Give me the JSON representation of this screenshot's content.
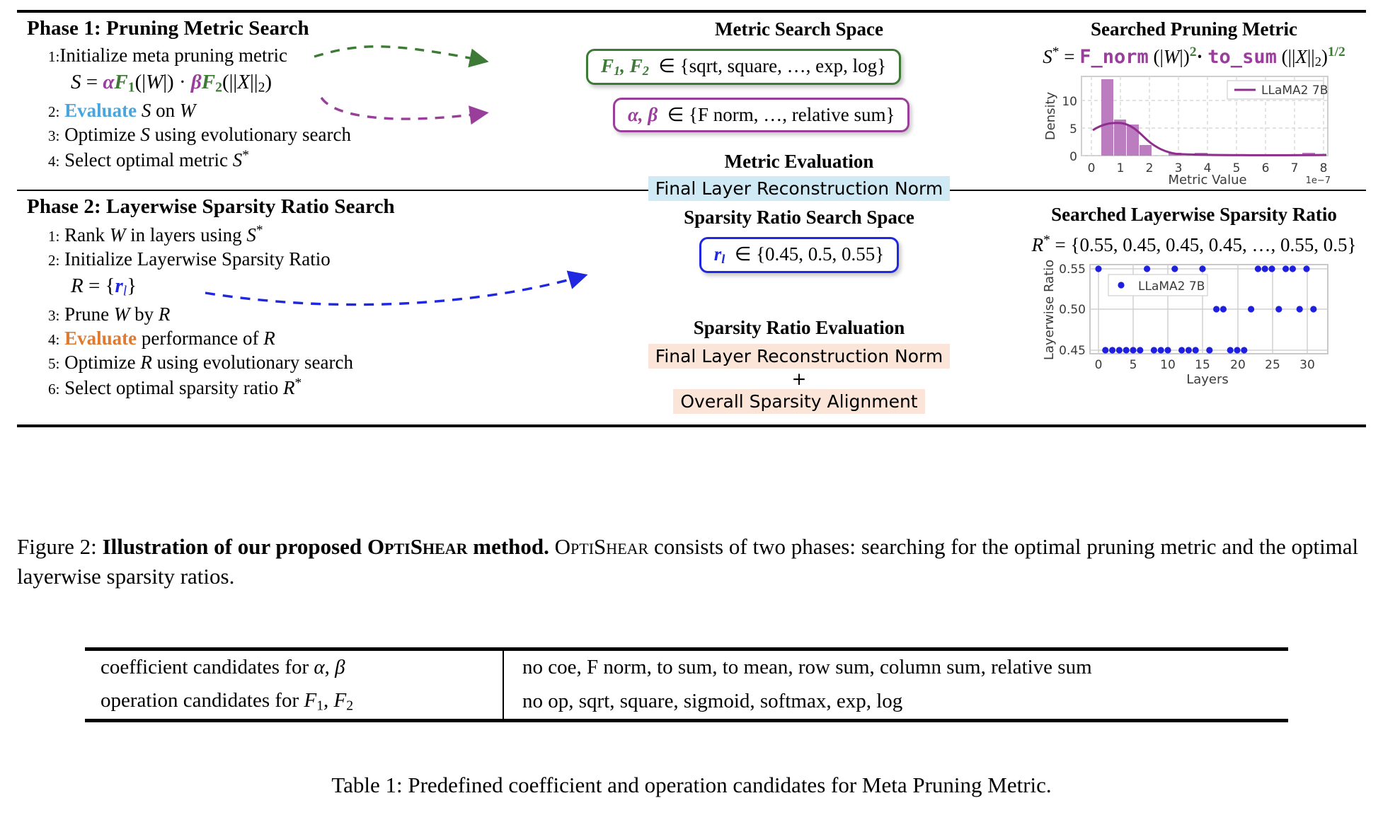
{
  "phase1": {
    "title": "Phase 1: Pruning Metric Search",
    "steps": [
      {
        "num": "1:",
        "text": "Initialize meta pruning metric"
      },
      {
        "num": "2:",
        "text": "Evaluate S on W"
      },
      {
        "num": "3:",
        "text": "Optimize S using evolutionary search"
      },
      {
        "num": "4:",
        "text": "Select optimal metric S*"
      }
    ],
    "equation": "S = αF₁(|W|) · βF₂(||X||₂)",
    "space_heading": "Metric Search Space",
    "space_box_1": "F₁, F₂ ∈ {sqrt, square, …, exp, log}",
    "space_box_2": "α, β ∈ {F norm, …, relative sum}",
    "eval_heading": "Metric Evaluation",
    "eval_item": "Final Layer Reconstruction Norm",
    "plot_heading": "Searched Pruning Metric",
    "plot_equation": "S* = F_norm (|W|)²· to_sum (||X||₂)¹ᐟ²"
  },
  "phase2": {
    "title": "Phase 2: Layerwise Sparsity Ratio Search",
    "steps": [
      {
        "num": "1:",
        "text": "Rank W in layers using S*"
      },
      {
        "num": "2:",
        "text": "Initialize Layerwise Sparsity Ratio"
      },
      {
        "num": "3:",
        "text": "Prune W by R"
      },
      {
        "num": "4:",
        "text": "Evaluate performance of R"
      },
      {
        "num": "5:",
        "text": "Optimize R using evolutionary search"
      },
      {
        "num": "6:",
        "text": "Select optimal sparsity ratio R*"
      }
    ],
    "equation": "R = {rₗ}",
    "space_heading": "Sparsity Ratio Search Space",
    "space_box_1": "rₗ ∈ {0.45, 0.5, 0.55}",
    "eval_heading": "Sparsity Ratio Evaluation",
    "eval_item_1": "Final Layer Reconstruction Norm",
    "eval_plus": "+",
    "eval_item_2": "Overall Sparsity Alignment",
    "plot_heading": "Searched Layerwise Sparsity Ratio",
    "plot_equation": "R* = {0.55, 0.45, 0.45, 0.45, …, 0.55, 0.5}"
  },
  "colors": {
    "purple": "#993f9b",
    "green": "#3c7a36",
    "blue": "#1f27e0",
    "light_blue": "#47a6dd",
    "orange": "#e07a2f",
    "highlight_blue": "#cfe9f5",
    "highlight_peach": "#fae5d8"
  },
  "chart_data": [
    {
      "type": "bar",
      "title": "",
      "xlabel": "Metric Value",
      "ylabel": "Density",
      "x_exponent": "1e−7",
      "xlim": [
        -0.35,
        8.6
      ],
      "ylim": [
        0,
        14.5
      ],
      "xticks": [
        "0",
        "1",
        "2",
        "3",
        "4",
        "5",
        "6",
        "7",
        "8"
      ],
      "yticks": [
        "0",
        "5",
        "10"
      ],
      "legend": [
        "LLaMA2 7B"
      ],
      "legend_position": "upper right",
      "grid": true,
      "bin_edges": [
        0.35,
        0.78,
        1.21,
        1.64,
        2.07,
        3.0,
        3.45,
        3.9,
        4.35,
        7.6,
        8.05
      ],
      "bars": [
        {
          "x0": 0.35,
          "x1": 0.78,
          "height": 13.9
        },
        {
          "x0": 0.78,
          "x1": 1.21,
          "height": 6.6
        },
        {
          "x0": 1.21,
          "x1": 1.64,
          "height": 5.7
        },
        {
          "x0": 1.64,
          "x1": 2.07,
          "height": 1.9
        },
        {
          "x0": 3.0,
          "x1": 3.45,
          "height": 0.55
        },
        {
          "x0": 3.9,
          "x1": 4.35,
          "height": 0.55
        },
        {
          "x0": 7.6,
          "x1": 8.05,
          "height": 0.55
        }
      ],
      "kde_curve": [
        [
          0.3,
          4.6
        ],
        [
          0.5,
          5.05
        ],
        [
          0.75,
          5.3
        ],
        [
          1.0,
          5.25
        ],
        [
          1.25,
          4.75
        ],
        [
          1.5,
          3.9
        ],
        [
          1.75,
          2.95
        ],
        [
          2.0,
          2.1
        ],
        [
          2.25,
          1.45
        ],
        [
          2.5,
          1.0
        ],
        [
          2.75,
          0.72
        ],
        [
          3.0,
          0.58
        ],
        [
          3.5,
          0.5
        ],
        [
          4.0,
          0.48
        ],
        [
          4.5,
          0.42
        ],
        [
          5.0,
          0.35
        ],
        [
          5.5,
          0.3
        ],
        [
          6.0,
          0.26
        ],
        [
          6.5,
          0.23
        ],
        [
          7.0,
          0.21
        ],
        [
          7.5,
          0.2
        ],
        [
          8.0,
          0.19
        ],
        [
          8.5,
          0.18
        ]
      ]
    },
    {
      "type": "scatter",
      "title": "",
      "xlabel": "Layers",
      "ylabel": "Layerwise Ratio",
      "xlim": [
        -1.2,
        32.5
      ],
      "ylim": [
        0.435,
        0.565
      ],
      "xticks": [
        "0",
        "5",
        "10",
        "15",
        "20",
        "25",
        "30"
      ],
      "yticks": [
        "0.45",
        "0.50",
        "0.55"
      ],
      "legend": [
        "LLaMA2 7B"
      ],
      "legend_position": "upper left",
      "grid": true,
      "x": [
        0,
        1,
        2,
        3,
        4,
        5,
        6,
        7,
        8,
        9,
        10,
        11,
        12,
        13,
        14,
        15,
        16,
        17,
        18,
        19,
        20,
        21,
        22,
        23,
        24,
        25,
        26,
        27,
        28,
        29,
        30,
        31
      ],
      "y": [
        0.55,
        0.45,
        0.45,
        0.45,
        0.45,
        0.45,
        0.45,
        0.55,
        0.45,
        0.45,
        0.45,
        0.55,
        0.45,
        0.45,
        0.45,
        0.55,
        0.45,
        0.5,
        0.5,
        0.45,
        0.45,
        0.45,
        0.5,
        0.55,
        0.55,
        0.55,
        0.5,
        0.55,
        0.55,
        0.5,
        0.55,
        0.5
      ]
    }
  ],
  "figure_caption": {
    "label": "Figure 2:",
    "bold_part": "Illustration of our proposed OptiShear method.",
    "rest_1": "OptiShear",
    "rest_2": "consists of two phases: searching for the optimal pruning metric and the optimal layerwise sparsity ratios."
  },
  "table": {
    "rows": [
      {
        "left": "coefficient candidates for α, β",
        "right": "no coe, F norm, to sum, to mean, row sum, column sum, relative sum"
      },
      {
        "left": "operation candidates for F₁, F₂",
        "right": "no op, sqrt, square, sigmoid, softmax, exp, log"
      }
    ],
    "caption": "Table 1: Predefined coefficient and operation candidates for Meta Pruning Metric."
  }
}
